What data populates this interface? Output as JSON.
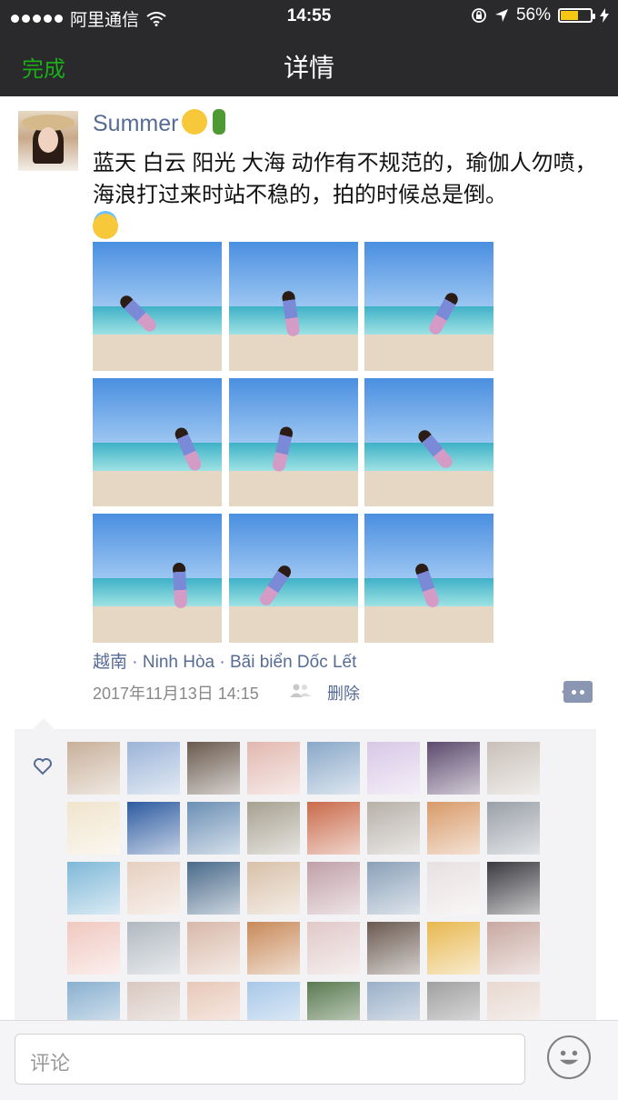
{
  "statusbar": {
    "carrier": "阿里通信",
    "time": "14:55",
    "battery_text": "56%",
    "battery_level": 0.56
  },
  "navbar": {
    "done_label": "完成",
    "title": "详情"
  },
  "post": {
    "username": "Summer",
    "text_line": "蓝天 白云 阳光 大海  动作有不规范的，瑜伽人勿喷，海浪打过来时站不稳的，拍的时候总是倒。",
    "location": "越南 · Ninh Hòa · Bãi biển Dốc Lết",
    "date": "2017年11月13日 14:15",
    "delete_label": "删除",
    "photo_count": 9
  },
  "likes": {
    "avatar_count": 40
  },
  "comment_bar": {
    "placeholder": "评论"
  },
  "colors": {
    "nav_bg": "#2a2a2c",
    "accent_green": "#1aad19",
    "link_blue": "#576b95",
    "battery_yellow": "#f6c614"
  },
  "icons": [
    "wifi-icon",
    "lock-rotation-icon",
    "location-arrow-icon",
    "battery-icon",
    "charging-icon",
    "people-icon",
    "comment-icon",
    "heart-icon",
    "emoji-icon"
  ]
}
